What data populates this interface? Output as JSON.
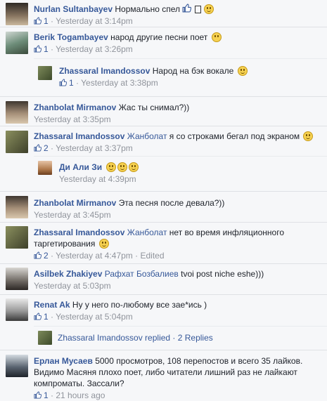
{
  "comments": [
    {
      "name": "Nurlan Sultanbayev",
      "text": "Нормально спел",
      "likes": "1",
      "time": "Yesterday at 3:14pm"
    },
    {
      "name": "Berik Togambayev",
      "text": "народ другие песни поет",
      "likes": "1",
      "time": "Yesterday at 3:26pm"
    },
    {
      "name": "Zhassaral Imandossov",
      "text": "Народ на бэк вокале",
      "likes": "1",
      "time": "Yesterday at 3:38pm"
    },
    {
      "name": "Zhanbolat Mirmanov",
      "text": "Жас ты снимал?))",
      "time": "Yesterday at 3:35pm"
    },
    {
      "name": "Zhassaral Imandossov",
      "mention": "Жанболат",
      "text": "я со строками бегал под экраном",
      "likes": "2",
      "time": "Yesterday at 3:37pm"
    },
    {
      "name": "Ди Али Зи",
      "text": "",
      "time": "Yesterday at 4:39pm"
    },
    {
      "name": "Zhanbolat Mirmanov",
      "text": "Эта песня после девала?))",
      "time": "Yesterday at 3:45pm"
    },
    {
      "name": "Zhassaral Imandossov",
      "mention": "Жанболат",
      "text": "нет во время инфляционного таргетирования",
      "likes": "2",
      "time": "Yesterday at 4:47pm",
      "edited": "Edited"
    },
    {
      "name": "Asilbek Zhakiyev",
      "mention": "Рафхат Бозбалиев",
      "text": "tvoi post niche eshe)))",
      "time": "Yesterday at 5:03pm"
    },
    {
      "name": "Renat Ak",
      "text": "Ну у него по-любому все зае*ись )",
      "likes": "1",
      "time": "Yesterday at 5:04pm"
    },
    {
      "name": "Ерлан Мусаев",
      "text": "5000 просмотров, 108 перепостов и всего 35 лайков. Видимо Масяня плохо поет, либо читатели лишний раз не лайкают компроматы. Зассали?",
      "likes": "1",
      "time": "21 hours ago"
    }
  ],
  "reply_summary": {
    "text": "Zhassaral Imandossov replied · 2 Replies"
  },
  "separator": "·"
}
